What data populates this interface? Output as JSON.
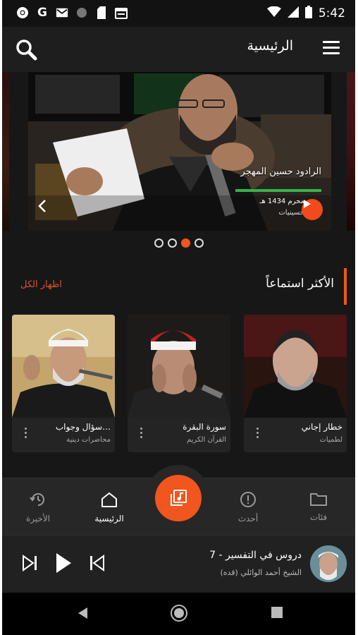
{
  "status_bar": {
    "time": "5:42",
    "left_icons": [
      "chrome-icon",
      "g-icon",
      "mail-icon",
      "circle-icon",
      "sd-icon",
      "calendar-icon"
    ],
    "right_icons": [
      "wifi-icon",
      "signal-icon",
      "battery-icon"
    ]
  },
  "app_bar": {
    "title": "الرئيسية"
  },
  "carousel": {
    "slide_title": "الرادود حسين المهجر",
    "slide_meta_1": "محرم 1434 هـ",
    "slide_meta_2": "حسينيات",
    "page_count": 4,
    "active_index": 2
  },
  "section": {
    "title": "الأكثر استماعاً",
    "show_all": "اظهار الكل"
  },
  "cards": [
    {
      "title": "خطار إجاني",
      "subtitle": "لطميات"
    },
    {
      "title": "سورة البقرة",
      "subtitle": "القرآن الكريم"
    },
    {
      "title": "سؤال وجواب…",
      "subtitle": "محاضرات دينية"
    }
  ],
  "bottom_nav": {
    "categories": "فئات",
    "latest": "أحدث",
    "home": "الرئيسية",
    "recent": "الأخيرة"
  },
  "player": {
    "title": "دروس في التفسير - 7",
    "artist": "الشيخ أحمد الوائلي (قده)"
  },
  "colors": {
    "accent": "#f0561d",
    "progress": "#36b24a",
    "background": "#171717"
  }
}
